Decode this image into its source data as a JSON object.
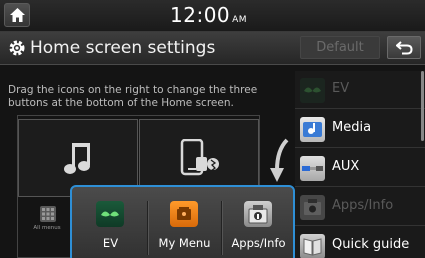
{
  "status": {
    "time": "12:00",
    "ampm": "AM"
  },
  "header": {
    "title": "Home screen settings",
    "default_label": "Default"
  },
  "instruction": "Drag the icons on the right to change the three buttons at the bottom of the Home screen.",
  "all_menus_label": "All menus",
  "popup": {
    "items": [
      {
        "label": "EV",
        "icon": "ev-leaf-icon"
      },
      {
        "label": "My Menu",
        "icon": "my-menu-icon"
      },
      {
        "label": "Apps/Info",
        "icon": "apps-info-icon"
      }
    ]
  },
  "list": {
    "items": [
      {
        "label": "EV",
        "icon": "ev-leaf-icon",
        "enabled": false
      },
      {
        "label": "Media",
        "icon": "media-icon",
        "enabled": true
      },
      {
        "label": "AUX",
        "icon": "aux-icon",
        "enabled": true
      },
      {
        "label": "Apps/Info",
        "icon": "apps-info-icon",
        "enabled": false
      },
      {
        "label": "Quick guide",
        "icon": "quick-guide-icon",
        "enabled": true
      }
    ]
  },
  "colors": {
    "accent": "#2e8fd6"
  }
}
